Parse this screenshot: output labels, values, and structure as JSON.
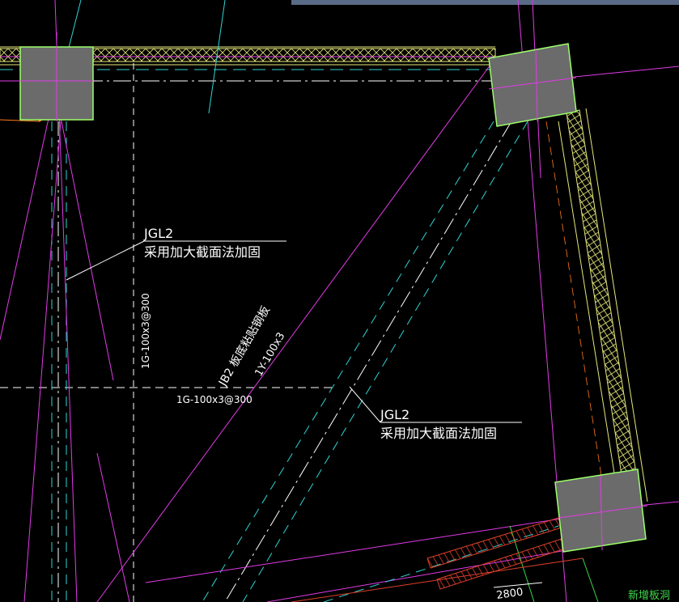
{
  "drawing": {
    "colors": {
      "background": "#000000",
      "column_fill": "#6b6b6b",
      "column_edge": "#9cff6a",
      "wall": "#e6e87a",
      "magenta": "#e23be8",
      "cyan": "#2fd4d4",
      "white": "#ffffff",
      "red_hatch": "#e0402a",
      "green": "#3cd84a",
      "orange": "#ff7a20"
    },
    "annotations": {
      "jgl2_upper_tag": "JGL2",
      "jgl2_upper_note": "采用加大截面法加固",
      "jgl2_lower_tag": "JGL2",
      "jgl2_lower_note": "采用加大截面法加固",
      "jb2_label": "JB2 板底粘贴钢板",
      "jb2_spec": "1Y-100x3",
      "vertical_rebar": "1G-100x3@300",
      "horizontal_rebar": "1G-100x3@300",
      "dimension_2800": "2800",
      "new_opening": "新增板洞"
    }
  }
}
